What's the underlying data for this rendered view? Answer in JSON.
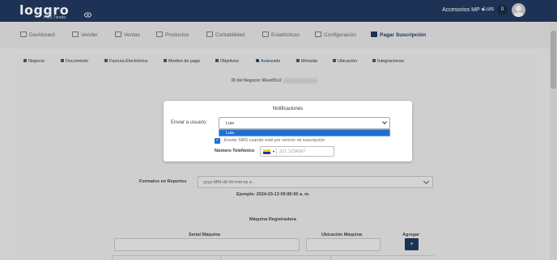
{
  "brand": {
    "logo_text": "loggro",
    "subtitle": "POS Tienda"
  },
  "topbar": {
    "account": "Accesorios MP ▾",
    "user": "Luis",
    "notifications": "0"
  },
  "nav": [
    {
      "label": "Dashboard",
      "icon": "dashboard-icon"
    },
    {
      "label": "Vender",
      "icon": "cart-icon"
    },
    {
      "label": "Ventas",
      "icon": "dollar-icon"
    },
    {
      "label": "Productos",
      "icon": "box-icon"
    },
    {
      "label": "Contabilidad",
      "icon": "calculator-icon"
    },
    {
      "label": "Estadísticas",
      "icon": "chart-icon"
    },
    {
      "label": "Configuración",
      "icon": "gear-icon"
    },
    {
      "label": "Pagar Suscripción",
      "icon": "card-icon",
      "active": true
    }
  ],
  "subnav": [
    {
      "label": "Negocio"
    },
    {
      "label": "Documento"
    },
    {
      "label": "Factura Electrónica"
    },
    {
      "label": "Medios de pago"
    },
    {
      "label": "Objetivos"
    },
    {
      "label": "Avanzado",
      "active": true
    },
    {
      "label": "Moneda"
    },
    {
      "label": "Ubicación"
    },
    {
      "label": "Integraciones"
    }
  ],
  "business": {
    "id_label": "ID del Negocio: 65ee0f1c2"
  },
  "formats": {
    "label": "Formatos en Reportes",
    "value": "yyyy-MM-dd hh:mm:ss a",
    "example": "Ejemplo: 2024-03-13 09:06:50 a. m."
  },
  "machines": {
    "title": "Máquina Registradora",
    "col_serial": "Serial Máquina",
    "col_location": "Ubicación Máquina",
    "col_add": "Agregar",
    "add_button": "+"
  },
  "modal": {
    "title": "Notificaciones",
    "send_to_label": "Enviar a usuario:",
    "selected_user": "Luis",
    "option_highlight": "Luis",
    "sms_label": "Enviar SMS cuando esté por vencer mi suscripción",
    "sms_checked": true,
    "phone_label": "Número Telefónico",
    "phone_placeholder": "321 1234567"
  },
  "colors": {
    "primary": "#21385e",
    "highlight": "#1f6fcf"
  }
}
